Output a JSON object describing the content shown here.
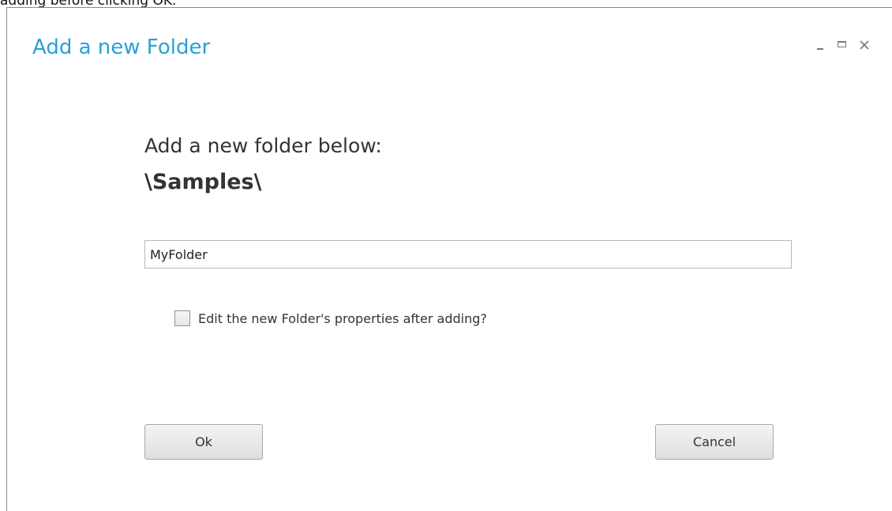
{
  "caption": {
    "text": "adding before clicking OK."
  },
  "dialog": {
    "title": "Add a new Folder",
    "title_color": "#2a9fd8",
    "controls": {
      "minimize_icon": "minimize-icon",
      "maximize_icon": "maximize-icon",
      "close_icon": "close-icon"
    },
    "prompt": "Add a new folder below:",
    "path": "\\Samples\\",
    "input": {
      "value": "MyFolder",
      "placeholder": ""
    },
    "checkbox": {
      "label": "Edit the new Folder's properties after adding?",
      "checked": false
    },
    "buttons": {
      "ok_label": "Ok",
      "cancel_label": "Cancel"
    }
  }
}
